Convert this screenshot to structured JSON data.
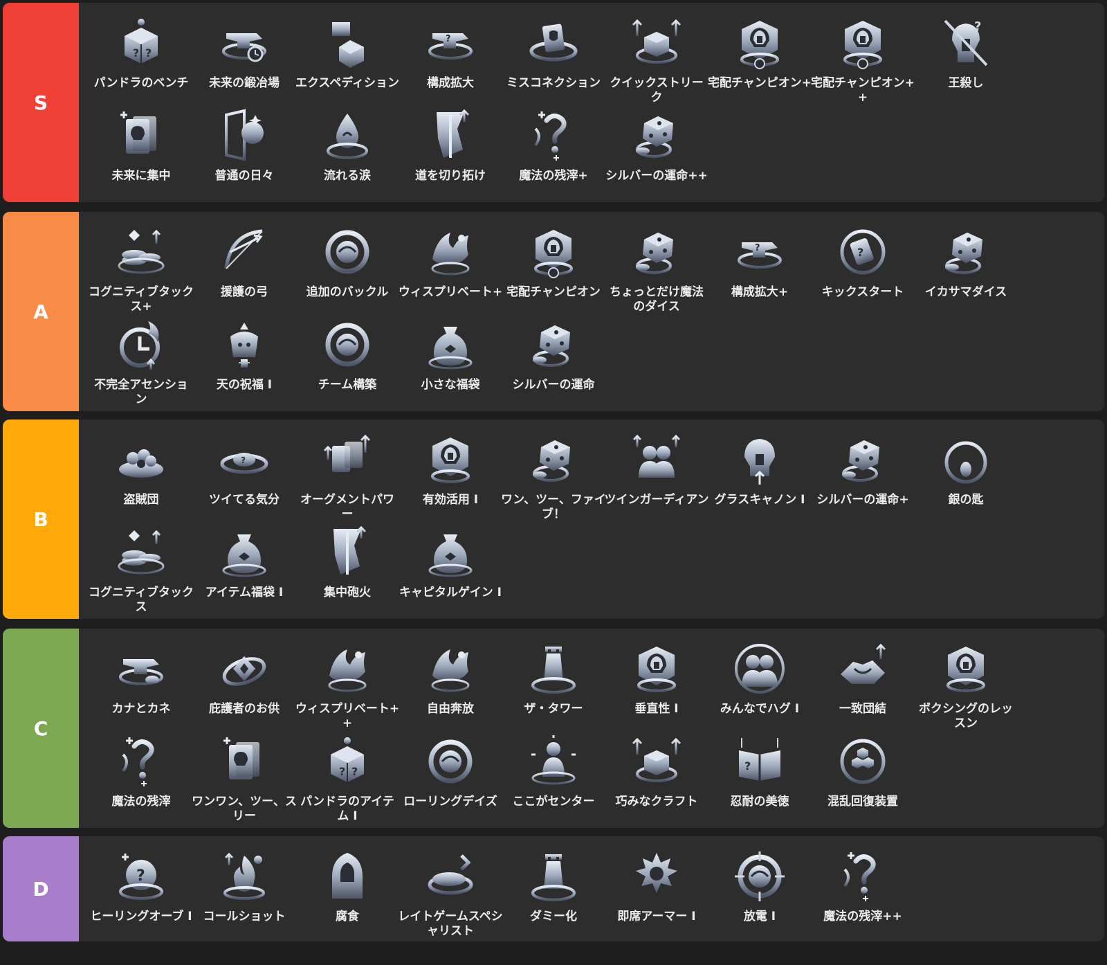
{
  "tiers": [
    {
      "label": "S",
      "color": "#f03f37",
      "items": [
        {
          "name": "パンドラのベンチ",
          "icon": "mystery-box-icon"
        },
        {
          "name": "未来の鍛冶場",
          "icon": "anvil-clock-icon"
        },
        {
          "name": "エクスペディション",
          "icon": "flag-box-icon"
        },
        {
          "name": "構成拡大",
          "icon": "anvil-question-icon"
        },
        {
          "name": "ミスコネクション",
          "icon": "card-swirl-icon"
        },
        {
          "name": "クイックストリーク",
          "icon": "box-arrows-icon"
        },
        {
          "name": "宅配チャンピオン+",
          "icon": "champion-helm-icon"
        },
        {
          "name": "宅配チャンピオン++",
          "icon": "champion-helm-icon"
        },
        {
          "name": "王殺し",
          "icon": "crossed-helm-icon"
        },
        {
          "name": "未来に集中",
          "icon": "card-sparkle-icon"
        },
        {
          "name": "普通の日々",
          "icon": "door-face-icon"
        },
        {
          "name": "流れる涙",
          "icon": "tear-drop-icon"
        },
        {
          "name": "道を切り拓け",
          "icon": "broken-banner-icon"
        },
        {
          "name": "魔法の残滓+",
          "icon": "magic-residue-icon"
        },
        {
          "name": "シルバーの運命++",
          "icon": "silver-dice-icon"
        }
      ]
    },
    {
      "label": "A",
      "color": "#f88b46",
      "items": [
        {
          "name": "コグニティブタックス+",
          "icon": "coin-stack-icon"
        },
        {
          "name": "援護の弓",
          "icon": "bow-icon"
        },
        {
          "name": "追加のバックル",
          "icon": "buckle-icon"
        },
        {
          "name": "ウィスプリベート+",
          "icon": "wisp-icon"
        },
        {
          "name": "宅配チャンピオン",
          "icon": "champion-helm-icon"
        },
        {
          "name": "ちょっとだけ魔法のダイス",
          "icon": "magic-dice-icon"
        },
        {
          "name": "構成拡大+",
          "icon": "anvil-question-icon"
        },
        {
          "name": "キックスタート",
          "icon": "kickstart-icon"
        },
        {
          "name": "イカサマダイス",
          "icon": "loaded-dice-icon"
        },
        {
          "name": "不完全アセンション",
          "icon": "fire-clock-icon"
        },
        {
          "name": "天の祝福 I",
          "icon": "blessing-icon"
        },
        {
          "name": "チーム構築",
          "icon": "team-orb-icon"
        },
        {
          "name": "小さな福袋",
          "icon": "small-bag-icon"
        },
        {
          "name": "シルバーの運命",
          "icon": "silver-dice-icon"
        }
      ]
    },
    {
      "label": "B",
      "color": "#ffa90b",
      "items": [
        {
          "name": "盗賊団",
          "icon": "bandit-pile-icon"
        },
        {
          "name": "ツイてる気分",
          "icon": "lucky-coin-icon"
        },
        {
          "name": "オーグメントパワー",
          "icon": "augment-card-icon"
        },
        {
          "name": "有効活用 I",
          "icon": "helm-swirl-icon"
        },
        {
          "name": "ワン、ツー、ファイブ！",
          "icon": "helm-dice-icon"
        },
        {
          "name": "ツインガーディアン",
          "icon": "twin-guard-icon"
        },
        {
          "name": "グラスキャノン I",
          "icon": "glass-cannon-icon"
        },
        {
          "name": "シルバーの運命+",
          "icon": "silver-dice-icon"
        },
        {
          "name": "銀の匙",
          "icon": "spoon-icon"
        },
        {
          "name": "コグニティブタックス",
          "icon": "coin-stack-icon"
        },
        {
          "name": "アイテム福袋 I",
          "icon": "item-bag-icon"
        },
        {
          "name": "集中砲火",
          "icon": "sword-focus-icon"
        },
        {
          "name": "キャピタルゲイン I",
          "icon": "money-bag-icon"
        }
      ]
    },
    {
      "label": "C",
      "color": "#7da852",
      "items": [
        {
          "name": "カナとカネ",
          "icon": "anvil-coin-icon"
        },
        {
          "name": "庇護者のお供",
          "icon": "guardian-icon"
        },
        {
          "name": "ウィスプリベート++",
          "icon": "wisp-icon"
        },
        {
          "name": "自由奔放",
          "icon": "freedom-icon"
        },
        {
          "name": "ザ・タワー",
          "icon": "tower-icon"
        },
        {
          "name": "垂直性 I",
          "icon": "vertical-helm-icon"
        },
        {
          "name": "みんなでハグ I",
          "icon": "hug-icon"
        },
        {
          "name": "一致団結",
          "icon": "handshake-icon"
        },
        {
          "name": "ボクシングのレッスン",
          "icon": "boxing-helm-icon"
        },
        {
          "name": "魔法の残滓",
          "icon": "magic-residue-icon"
        },
        {
          "name": "ワンワン、ツー、スリー",
          "icon": "champion-card-icon"
        },
        {
          "name": "パンドラのアイテム I",
          "icon": "question-box-icon"
        },
        {
          "name": "ローリングデイズ",
          "icon": "rolling-days-icon"
        },
        {
          "name": "ここがセンター",
          "icon": "center-figure-icon"
        },
        {
          "name": "巧みなクラフト",
          "icon": "craft-box-icon"
        },
        {
          "name": "忍耐の美徳",
          "icon": "patience-book-icon"
        },
        {
          "name": "混乱回復装置",
          "icon": "hex-cluster-icon"
        }
      ]
    },
    {
      "label": "D",
      "color": "#a87dcc",
      "items": [
        {
          "name": "ヒーリングオーブ I",
          "icon": "healing-orb-icon"
        },
        {
          "name": "コールショット",
          "icon": "flame-shot-icon"
        },
        {
          "name": "腐食",
          "icon": "hooded-figure-icon"
        },
        {
          "name": "レイトゲームスペシャリスト",
          "icon": "late-game-icon"
        },
        {
          "name": "ダミー化",
          "icon": "dummy-crown-icon"
        },
        {
          "name": "即席アーマー I",
          "icon": "armor-burst-icon"
        },
        {
          "name": "放電 I",
          "icon": "discharge-icon"
        },
        {
          "name": "魔法の残滓++",
          "icon": "magic-residue-icon"
        }
      ]
    }
  ]
}
